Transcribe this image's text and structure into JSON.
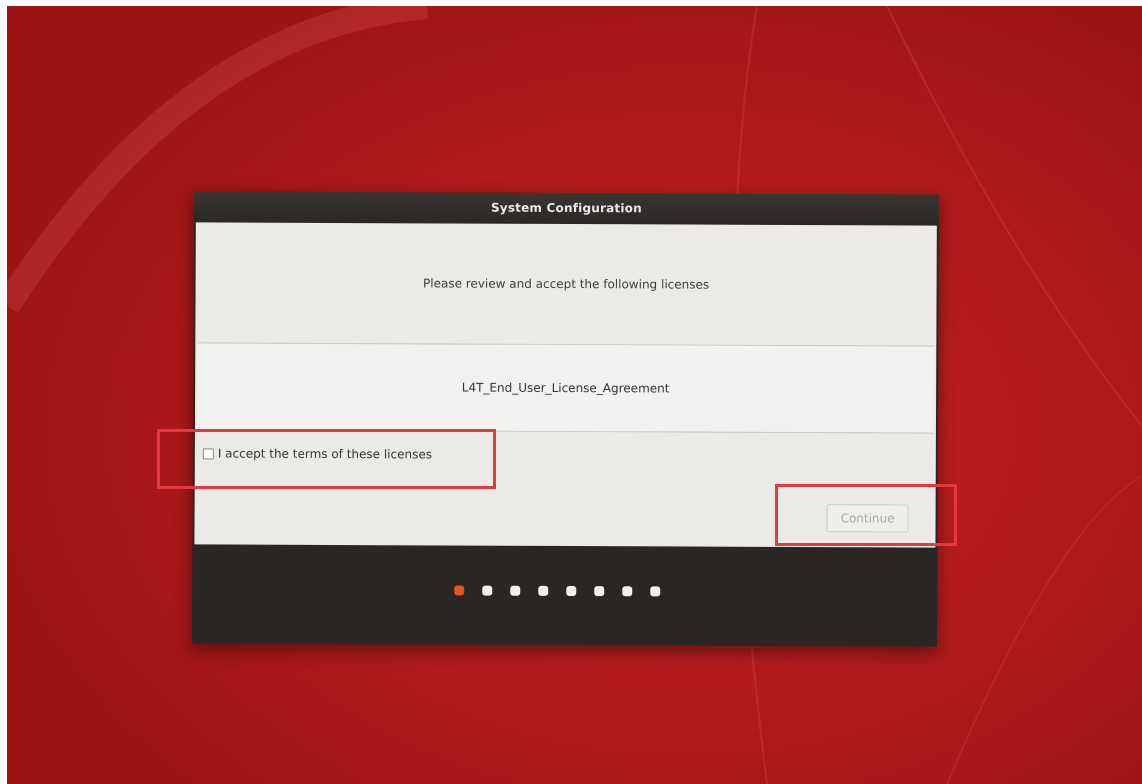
{
  "window": {
    "title": "System Configuration"
  },
  "licenses": {
    "intro": "Please review and accept the following licenses",
    "items": [
      {
        "name": "L4T_End_User_License_Agreement"
      }
    ],
    "accept_label": "I accept the terms of these licenses",
    "accept_checked": false
  },
  "actions": {
    "continue_label": "Continue",
    "continue_enabled": false
  },
  "progress": {
    "total_steps": 8,
    "current_step": 1
  },
  "colors": {
    "wallpaper": "#b51c1c",
    "dialog_frame": "#2a2624",
    "content_bg": "#ebeae7",
    "active_dot": "#e2571f",
    "inactive_dot": "#f2f0ec",
    "annotation": "#e23a3f"
  }
}
